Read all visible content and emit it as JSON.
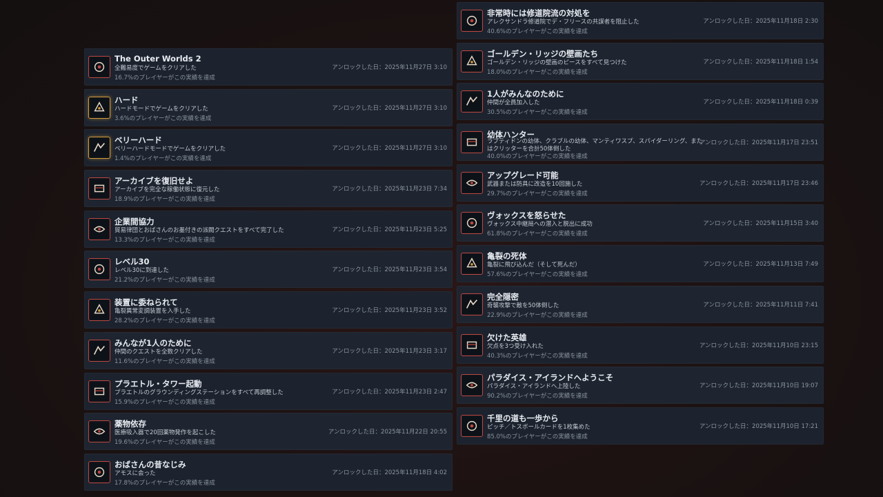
{
  "left_column": [
    {
      "title": "The Outer Worlds 2",
      "desc": "全難易度でゲームをクリアした",
      "pct": "16.7%のプレイヤーがこの実績を達成",
      "unlock": "アンロックした日：2025年11月27日 3:10",
      "icon": "trophy-icon",
      "gold": false
    },
    {
      "title": "ハード",
      "desc": "ハードモードでゲームをクリアした",
      "pct": "3.6%のプレイヤーがこの実績を達成",
      "unlock": "アンロックした日：2025年11月27日 3:10",
      "icon": "hard-mode-icon",
      "gold": true
    },
    {
      "title": "ベリーハード",
      "desc": "ベリーハードモードでゲームをクリアした",
      "pct": "1.4%のプレイヤーがこの実績を達成",
      "unlock": "アンロックした日：2025年11月27日 3:10",
      "icon": "very-hard-mode-icon",
      "gold": true
    },
    {
      "title": "アーカイブを復旧せよ",
      "desc": "アーカイブを完全な稼働状態に復元した",
      "pct": "18.9%のプレイヤーがこの実績を達成",
      "unlock": "アンロックした日：2025年11月23日 7:34",
      "icon": "archive-icon",
      "gold": false
    },
    {
      "title": "企業間協力",
      "desc": "貿易律団とおばさんのお墨付きの派閥クエストをすべて完了した",
      "pct": "13.3%のプレイヤーがこの実績を達成",
      "unlock": "アンロックした日：2025年11月23日 5:25",
      "icon": "handshake-icon",
      "gold": false
    },
    {
      "title": "レベル30",
      "desc": "レベル30に到達した",
      "pct": "21.2%のプレイヤーがこの実績を達成",
      "unlock": "アンロックした日：2025年11月23日 3:54",
      "icon": "level-up-icon",
      "gold": false
    },
    {
      "title": "装置に委ねられて",
      "desc": "亀裂異常変調装置を入手した",
      "pct": "28.2%のプレイヤーがこの実績を達成",
      "unlock": "アンロックした日：2025年11月23日 3:52",
      "icon": "device-icon",
      "gold": false
    },
    {
      "title": "みんなが1人のために",
      "desc": "仲間のクエストを全数クリアした",
      "pct": "11.6%のプレイヤーがこの実績を達成",
      "unlock": "アンロックした日：2025年11月23日 3:17",
      "icon": "companions-icon",
      "gold": false
    },
    {
      "title": "プラエトル・タワー起動",
      "desc": "プラエトルのグラウンディングステーションをすべて再調整した",
      "pct": "15.9%のプレイヤーがこの実績を達成",
      "unlock": "アンロックした日：2025年11月23日 2:47",
      "icon": "tower-icon",
      "gold": false
    },
    {
      "title": "薬物依存",
      "desc": "医療吸入器で20回薬物発作を起こした",
      "pct": "19.6%のプレイヤーがこの実績を達成",
      "unlock": "アンロックした日：2025年11月22日 20:55",
      "icon": "inhaler-icon",
      "gold": false
    },
    {
      "title": "おばさんの昔なじみ",
      "desc": "アモスに会った",
      "pct": "17.8%のプレイヤーがこの実績を達成",
      "unlock": "アンロックした日：2025年11月18日 4:02",
      "icon": "rocket-icon",
      "gold": false
    }
  ],
  "right_column": [
    {
      "title": "非常時には修道院流の対処を",
      "desc": "アレクサンドラ修道院でデ・フリースの共謀者を阻止した",
      "pct": "40.6%のプレイヤーがこの実績を達成",
      "unlock": "アンロックした日：2025年11月18日 2:30",
      "icon": "monastery-icon",
      "gold": false
    },
    {
      "title": "ゴールデン・リッジの壁画たち",
      "desc": "ゴールデン・リッジの壁画のピースをすべて見つけた",
      "pct": "18.0%のプレイヤーがこの実績を達成",
      "unlock": "アンロックした日：2025年11月18日 1:54",
      "icon": "mural-icon",
      "gold": false
    },
    {
      "title": "1人がみんなのために",
      "desc": "仲間が全員加入した",
      "pct": "30.5%のプレイヤーがこの実績を達成",
      "unlock": "アンロックした日：2025年11月18日 0:39",
      "icon": "moon-icon",
      "gold": false
    },
    {
      "title": "幼体ハンター",
      "desc": "ラプティドンの幼体、クラブルの幼体、マンティワスプ、スパイダーリング、またはクリッターを合計50体倒した",
      "pct": "40.0%のプレイヤーがこの実績を達成",
      "unlock": "アンロックした日：2025年11月17日 23:51",
      "icon": "hunter-icon",
      "gold": false,
      "two_line": true
    },
    {
      "title": "アップグレード可能",
      "desc": "武器または防具に改造を10回施した",
      "pct": "29.7%のプレイヤーがこの実績を達成",
      "unlock": "アンロックした日：2025年11月17日 23:46",
      "icon": "upgrade-icon",
      "gold": false
    },
    {
      "title": "ヴォックスを怒らせた",
      "desc": "ヴォックス中継局への潜入と脱出に成功",
      "pct": "61.8%のプレイヤーがこの実績を達成",
      "unlock": "アンロックした日：2025年11月15日 3:40",
      "icon": "explosion-icon",
      "gold": false
    },
    {
      "title": "亀裂の死体",
      "desc": "亀裂に飛び込んだ（そして死んだ）",
      "pct": "57.6%のプレイヤーがこの実績を達成",
      "unlock": "アンロックした日：2025年11月13日 7:49",
      "icon": "rift-icon",
      "gold": false
    },
    {
      "title": "完全隠密",
      "desc": "奇襲攻撃で敵を50体倒した",
      "pct": "22.9%のプレイヤーがこの実績を達成",
      "unlock": "アンロックした日：2025年11月11日 7:41",
      "icon": "stealth-icon",
      "gold": false
    },
    {
      "title": "欠けた英雄",
      "desc": "欠点を3つ受け入れた",
      "pct": "40.3%のプレイヤーがこの実績を達成",
      "unlock": "アンロックした日：2025年11月10日 23:15",
      "icon": "flawed-hero-icon",
      "gold": false
    },
    {
      "title": "パラダイス・アイランドへようこそ",
      "desc": "パラダイス・アイランドへ上陸した",
      "pct": "90.2%のプレイヤーがこの実績を達成",
      "unlock": "アンロックした日：2025年11月10日 19:07",
      "icon": "island-icon",
      "gold": false
    },
    {
      "title": "千里の道も一歩から",
      "desc": "ピッチ／トスボールカードを1枚集めた",
      "pct": "85.0%のプレイヤーがこの実績を達成",
      "unlock": "アンロックした日：2025年11月10日 17:21",
      "icon": "card-icon",
      "gold": false
    }
  ]
}
